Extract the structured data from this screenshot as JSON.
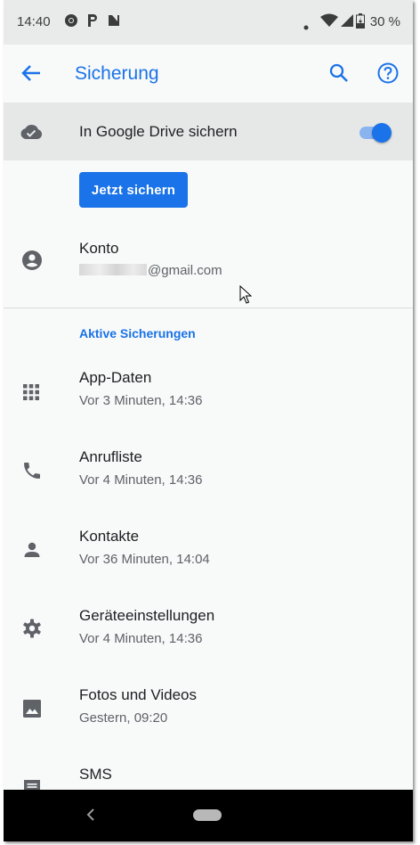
{
  "status_bar": {
    "time": "14:40",
    "battery": "30 %",
    "notification_icons": [
      "chrome-icon",
      "p-icon",
      "n-icon"
    ]
  },
  "app_bar": {
    "title": "Sicherung",
    "icons": [
      "back-arrow-icon",
      "search-icon",
      "help-icon"
    ]
  },
  "drive_backup": {
    "label": "In Google Drive sichern",
    "enabled": true,
    "button_label": "Jetzt sichern"
  },
  "account": {
    "title": "Konto",
    "email_visible_part": "@gmail.com"
  },
  "section": {
    "header": "Aktive Sicherungen",
    "items": [
      {
        "title": "App-Daten",
        "subtitle": "Vor 3 Minuten, 14:36",
        "icon": "apps-grid-icon"
      },
      {
        "title": "Anrufliste",
        "subtitle": "Vor 4 Minuten, 14:36",
        "icon": "phone-icon"
      },
      {
        "title": "Kontakte",
        "subtitle": "Vor 36 Minuten, 14:04",
        "icon": "person-icon"
      },
      {
        "title": "Geräteeinstellungen",
        "subtitle": "Vor 4 Minuten, 14:36",
        "icon": "gear-icon"
      },
      {
        "title": "Fotos und Videos",
        "subtitle": "Gestern, 09:20",
        "icon": "image-icon"
      },
      {
        "title": "SMS",
        "subtitle": "",
        "icon": "message-icon"
      }
    ]
  },
  "colors": {
    "accent": "#1a73e8",
    "background": "#f8f9f9",
    "status_bar": "#e9ebeb",
    "highlight_row": "#e6e8e8",
    "icon_gray": "#5f6368"
  }
}
